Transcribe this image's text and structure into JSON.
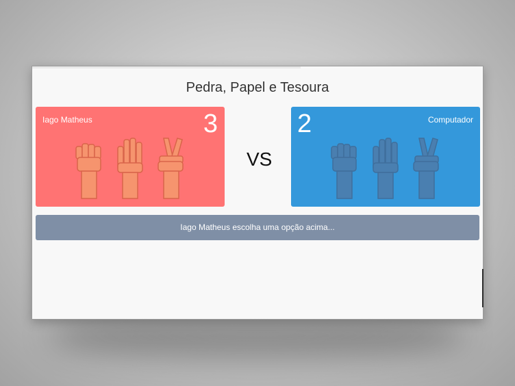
{
  "game": {
    "title": "Pedra, Papel e Tesoura",
    "vs_label": "VS"
  },
  "player": {
    "name": "Iago Matheus",
    "score": "3",
    "color": "#ff7373",
    "options": [
      "rock-hand-icon",
      "paper-hand-icon",
      "scissors-hand-icon"
    ]
  },
  "computer": {
    "name": "Computador",
    "score": "2",
    "color": "#3498db",
    "options": [
      "rock-hand-icon",
      "paper-hand-icon",
      "scissors-hand-icon"
    ]
  },
  "status": {
    "message": "Iago Matheus escolha uma opção acima...",
    "color": "#7f8fa6"
  }
}
